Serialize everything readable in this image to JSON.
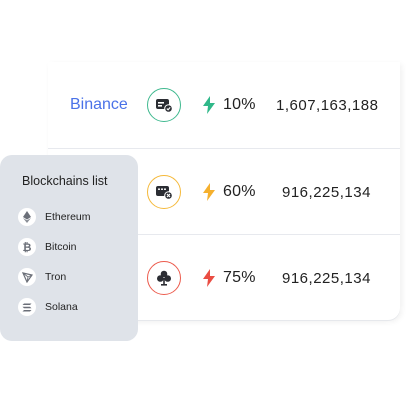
{
  "rows": [
    {
      "exchange": "Binance",
      "percent": "10%",
      "volume": "1,607,163,188",
      "badge_color": "#3fb98f",
      "bolt_color": "#2fb889",
      "badge_icon": "card-check-icon"
    },
    {
      "exchange": "",
      "percent": "60%",
      "volume": "916,225,134",
      "badge_color": "#f5b93a",
      "bolt_color": "#f5b02e",
      "badge_icon": "card-x-icon"
    },
    {
      "exchange": "",
      "percent": "75%",
      "volume": "916,225,134",
      "badge_color": "#ec5b4d",
      "bolt_color": "#ea4d43",
      "badge_icon": "club-icon"
    }
  ],
  "panel": {
    "title": "Blockchains list",
    "items": [
      {
        "label": "Ethereum",
        "icon": "ethereum-icon"
      },
      {
        "label": "Bitcoin",
        "icon": "bitcoin-icon"
      },
      {
        "label": "Tron",
        "icon": "tron-icon"
      },
      {
        "label": "Solana",
        "icon": "solana-icon"
      }
    ]
  },
  "colors": {
    "accent": "#4a72e8",
    "panel_bg": "#dfe3e9"
  }
}
